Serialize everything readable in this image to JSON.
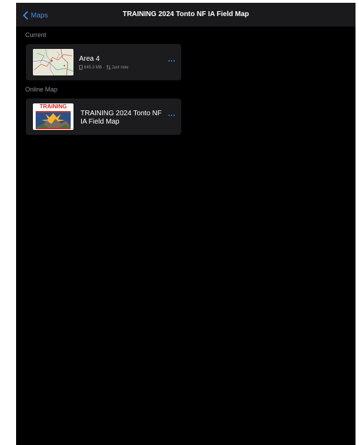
{
  "nav": {
    "back_label": "Maps",
    "title": "TRAINING 2024 Tonto NF IA Field Map"
  },
  "sections": {
    "current_header": "Current",
    "online_header": "Online Map"
  },
  "current_map": {
    "title": "Area 4",
    "size": "645.3 MB",
    "separator": "·",
    "sync_status": "Just now",
    "more": "···"
  },
  "online_map": {
    "title": "TRAINING 2024 Tonto NF IA Field Map",
    "badge_text": "TRAINING",
    "more": "···"
  },
  "colors": {
    "accent": "#3a8ef6",
    "background": "#000000",
    "card": "#1c1c1e",
    "nav": "#1a1a1c",
    "secondary_text": "#8e8e93",
    "training_red": "#e0201c"
  },
  "icons": {
    "back": "chevron-left-icon",
    "storage": "device-storage-icon",
    "sync": "sync-arrows-icon",
    "more": "ellipsis-icon"
  }
}
